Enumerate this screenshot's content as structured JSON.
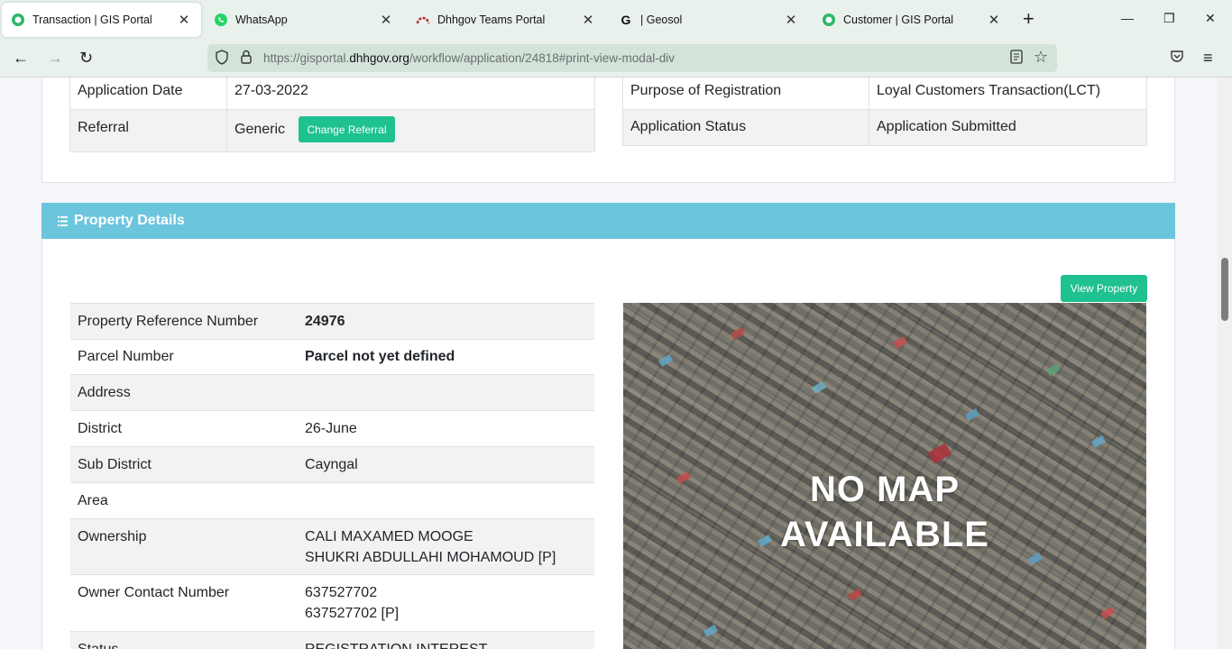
{
  "browser": {
    "tabs": [
      {
        "label": "Transaction | GIS Portal",
        "icon": "gis-portal-icon"
      },
      {
        "label": "WhatsApp",
        "icon": "whatsapp-icon"
      },
      {
        "label": "Dhhgov Teams Portal",
        "icon": "teams-portal-icon"
      },
      {
        "label": "| Geosol",
        "icon": "geosol-icon"
      },
      {
        "label": "Customer | GIS Portal",
        "icon": "gis-portal-icon"
      }
    ],
    "url_prefix": "https://gisportal.",
    "url_domain": "dhhgov.org",
    "url_suffix": "/workflow/application/24818#print-view-modal-div"
  },
  "application": {
    "left": [
      {
        "label": "Application Date",
        "value": "27-03-2022"
      },
      {
        "label": "Referral",
        "value": "Generic"
      }
    ],
    "change_referral_label": "Change Referral",
    "right": [
      {
        "label": "Purpose of Registration",
        "value": "Loyal Customers Transaction(LCT)"
      },
      {
        "label": "Application Status",
        "value": "Application Submitted"
      }
    ]
  },
  "property": {
    "title": "Property Details",
    "view_property_label": "View Property",
    "rows": [
      {
        "label": "Property Reference Number",
        "value": "24976"
      },
      {
        "label": "Parcel Number",
        "value": "Parcel not yet defined"
      },
      {
        "label": "Address",
        "value": ""
      },
      {
        "label": "District",
        "value": "26-June"
      },
      {
        "label": "Sub District",
        "value": "Cayngal"
      },
      {
        "label": "Area",
        "value": ""
      },
      {
        "label": "Ownership",
        "value": "CALI MAXAMED MOOGE",
        "value2": "SHUKRI ABDULLAHI MOHAMOUD [P]"
      },
      {
        "label": "Owner Contact Number",
        "value": "637527702",
        "value2": "637527702 [P]"
      },
      {
        "label": "Status",
        "value": "REGISTRATION INTEREST"
      }
    ],
    "map_text_line1": "NO MAP",
    "map_text_line2": "AVAILABLE"
  },
  "colors": {
    "accent_green": "#1ec18f",
    "section_header": "#6bc5dd"
  }
}
